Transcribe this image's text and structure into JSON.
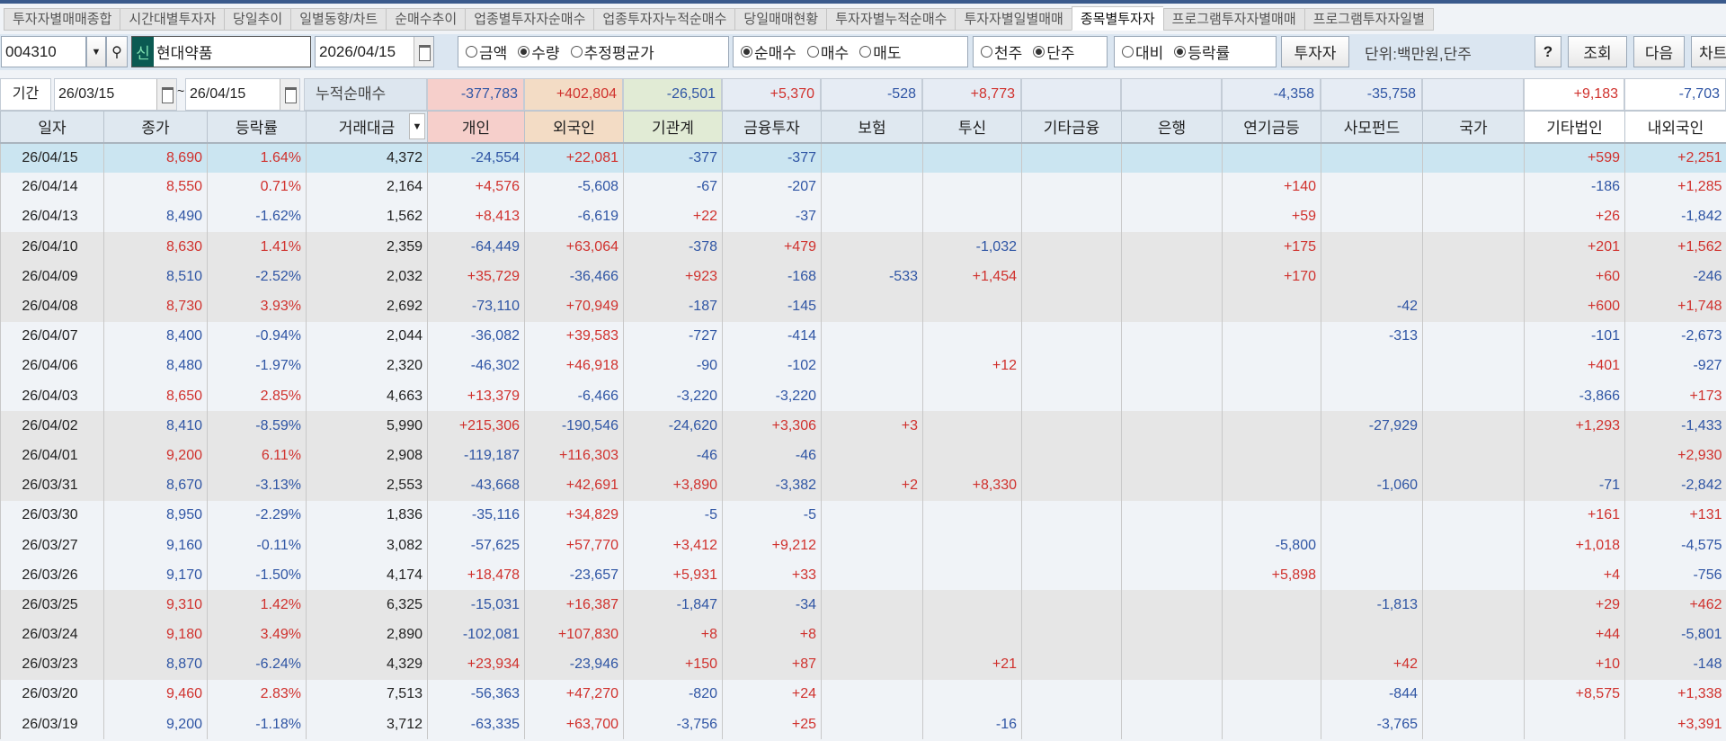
{
  "tabs": [
    "투자자별매매종합",
    "시간대별투자자",
    "당일추이",
    "일별동향/차트",
    "순매수추이",
    "업종별투자자순매수",
    "업종투자자누적순매수",
    "당일매매현황",
    "투자자별누적순매수",
    "투자자별일별매매",
    "종목별투자자",
    "프로그램투자자별매매",
    "프로그램투자자일별"
  ],
  "active_tab": "종목별투자자",
  "toolbar": {
    "code": "004310",
    "credit_badge": "신",
    "name": "현대약품",
    "date": "2026/04/15",
    "group1": [
      {
        "label": "금액",
        "on": false
      },
      {
        "label": "수량",
        "on": true
      },
      {
        "label": "추정평균가",
        "on": false
      }
    ],
    "group2": [
      {
        "label": "순매수",
        "on": true
      },
      {
        "label": "매수",
        "on": false
      },
      {
        "label": "매도",
        "on": false
      }
    ],
    "group3": [
      {
        "label": "천주",
        "on": false
      },
      {
        "label": "단주",
        "on": true
      }
    ],
    "group4": [
      {
        "label": "대비",
        "on": false
      },
      {
        "label": "등락률",
        "on": true
      }
    ],
    "investor_btn": "투자자",
    "unit": "단위:백만원,단주",
    "help": "?",
    "query": "조회",
    "next": "다음",
    "chart": "차트"
  },
  "period": {
    "label": "기간",
    "from": "26/03/15",
    "tilde": "~",
    "to": "26/04/15",
    "cum_label": "누적순매수",
    "totals": [
      "-377,783",
      "+402,804",
      "-26,501",
      "+5,370",
      "-528",
      "+8,773",
      "",
      "",
      "-4,358",
      "-35,758",
      "",
      "+9,183",
      "-7,703"
    ]
  },
  "columns": [
    "일자",
    "종가",
    "등락률",
    "거래대금",
    "개인",
    "외국인",
    "기관계",
    "금융투자",
    "보험",
    "투신",
    "기타금융",
    "은행",
    "연기금등",
    "사모펀드",
    "국가",
    "기타법인",
    "내외국인"
  ],
  "rows": [
    [
      "26/04/15",
      "8,690",
      "1.64%",
      "4,372",
      "-24,554",
      "+22,081",
      "-377",
      "-377",
      "",
      "",
      "",
      "",
      "",
      "",
      "",
      "+599",
      "+2,251"
    ],
    [
      "26/04/14",
      "8,550",
      "0.71%",
      "2,164",
      "+4,576",
      "-5,608",
      "-67",
      "-207",
      "",
      "",
      "",
      "",
      "+140",
      "",
      "",
      "-186",
      "+1,285"
    ],
    [
      "26/04/13",
      "8,490",
      "-1.62%",
      "1,562",
      "+8,413",
      "-6,619",
      "+22",
      "-37",
      "",
      "",
      "",
      "",
      "+59",
      "",
      "",
      "+26",
      "-1,842"
    ],
    [
      "26/04/10",
      "8,630",
      "1.41%",
      "2,359",
      "-64,449",
      "+63,064",
      "-378",
      "+479",
      "",
      "-1,032",
      "",
      "",
      "+175",
      "",
      "",
      "+201",
      "+1,562"
    ],
    [
      "26/04/09",
      "8,510",
      "-2.52%",
      "2,032",
      "+35,729",
      "-36,466",
      "+923",
      "-168",
      "-533",
      "+1,454",
      "",
      "",
      "+170",
      "",
      "",
      "+60",
      "-246"
    ],
    [
      "26/04/08",
      "8,730",
      "3.93%",
      "2,692",
      "-73,110",
      "+70,949",
      "-187",
      "-145",
      "",
      "",
      "",
      "",
      "",
      "-42",
      "",
      "+600",
      "+1,748"
    ],
    [
      "26/04/07",
      "8,400",
      "-0.94%",
      "2,044",
      "-36,082",
      "+39,583",
      "-727",
      "-414",
      "",
      "",
      "",
      "",
      "",
      "-313",
      "",
      "-101",
      "-2,673"
    ],
    [
      "26/04/06",
      "8,480",
      "-1.97%",
      "2,320",
      "-46,302",
      "+46,918",
      "-90",
      "-102",
      "",
      "+12",
      "",
      "",
      "",
      "",
      "",
      "+401",
      "-927"
    ],
    [
      "26/04/03",
      "8,650",
      "2.85%",
      "4,663",
      "+13,379",
      "-6,466",
      "-3,220",
      "-3,220",
      "",
      "",
      "",
      "",
      "",
      "",
      "",
      "-3,866",
      "+173"
    ],
    [
      "26/04/02",
      "8,410",
      "-8.59%",
      "5,990",
      "+215,306",
      "-190,546",
      "-24,620",
      "+3,306",
      "+3",
      "",
      "",
      "",
      "",
      "-27,929",
      "",
      "+1,293",
      "-1,433"
    ],
    [
      "26/04/01",
      "9,200",
      "6.11%",
      "2,908",
      "-119,187",
      "+116,303",
      "-46",
      "-46",
      "",
      "",
      "",
      "",
      "",
      "",
      "",
      "",
      "+2,930"
    ],
    [
      "26/03/31",
      "8,670",
      "-3.13%",
      "2,553",
      "-43,668",
      "+42,691",
      "+3,890",
      "-3,382",
      "+2",
      "+8,330",
      "",
      "",
      "",
      "-1,060",
      "",
      "-71",
      "-2,842"
    ],
    [
      "26/03/30",
      "8,950",
      "-2.29%",
      "1,836",
      "-35,116",
      "+34,829",
      "-5",
      "-5",
      "",
      "",
      "",
      "",
      "",
      "",
      "",
      "+161",
      "+131"
    ],
    [
      "26/03/27",
      "9,160",
      "-0.11%",
      "3,082",
      "-57,625",
      "+57,770",
      "+3,412",
      "+9,212",
      "",
      "",
      "",
      "",
      "-5,800",
      "",
      "",
      "+1,018",
      "-4,575"
    ],
    [
      "26/03/26",
      "9,170",
      "-1.50%",
      "4,174",
      "+18,478",
      "-23,657",
      "+5,931",
      "+33",
      "",
      "",
      "",
      "",
      "+5,898",
      "",
      "",
      "+4",
      "-756"
    ],
    [
      "26/03/25",
      "9,310",
      "1.42%",
      "6,325",
      "-15,031",
      "+16,387",
      "-1,847",
      "-34",
      "",
      "",
      "",
      "",
      "",
      "-1,813",
      "",
      "+29",
      "+462"
    ],
    [
      "26/03/24",
      "9,180",
      "3.49%",
      "2,890",
      "-102,081",
      "+107,830",
      "+8",
      "+8",
      "",
      "",
      "",
      "",
      "",
      "",
      "",
      "+44",
      "-5,801"
    ],
    [
      "26/03/23",
      "8,870",
      "-6.24%",
      "4,329",
      "+23,934",
      "-23,946",
      "+150",
      "+87",
      "",
      "+21",
      "",
      "",
      "",
      "+42",
      "",
      "+10",
      "-148"
    ],
    [
      "26/03/20",
      "9,460",
      "2.83%",
      "7,513",
      "-56,363",
      "+47,270",
      "-820",
      "+24",
      "",
      "",
      "",
      "",
      "",
      "-844",
      "",
      "+8,575",
      "+1,338"
    ],
    [
      "26/03/19",
      "9,200",
      "-1.18%",
      "3,712",
      "-63,335",
      "+63,700",
      "-3,756",
      "+25",
      "",
      "-16",
      "",
      "",
      "",
      "-3,765",
      "",
      "",
      "+3,391"
    ]
  ],
  "colors": {
    "up": "#d0312d",
    "down": "#2f55a4",
    "selected_row": "#cbe5f1",
    "group_row": "#e6e6e6",
    "individual_head": "#f6cfcb",
    "foreign_head": "#f3dcc5",
    "institution_head": "#e1ebd5"
  }
}
